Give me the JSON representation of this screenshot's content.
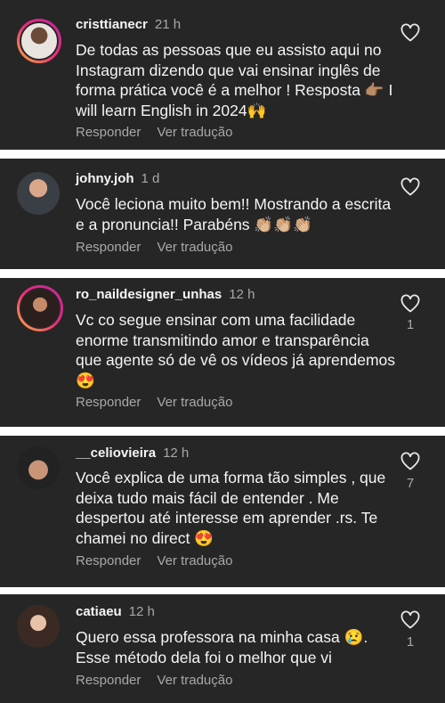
{
  "comments": [
    {
      "username": "cristtianecr",
      "time": "21 h",
      "text": "De todas as pessoas que eu assisto aqui no Instagram dizendo que vai ensinar inglês de forma prática você é a melhor ! Resposta 👉🏽 I will learn English in 2024🙌",
      "reply_label": "Responder",
      "translate_label": "Ver tradução",
      "likes": ""
    },
    {
      "username": "johny.joh",
      "time": "1 d",
      "text": "Você leciona muito bem!! Mostrando a escrita e a pronuncia!! Parabéns 👏🏼👏🏼👏🏼",
      "reply_label": "Responder",
      "translate_label": "Ver tradução",
      "likes": ""
    },
    {
      "username": "ro_naildesigner_unhas",
      "time": "12 h",
      "text": "Vc co segue ensinar com uma facilidade enorme transmitindo amor e transparência que agente só de vê os vídeos já aprendemos😍",
      "reply_label": "Responder",
      "translate_label": "Ver tradução",
      "likes": "1"
    },
    {
      "username": "__celiovieira",
      "time": "12 h",
      "text": "Você explica de uma forma tão simples , que deixa tudo mais fácil de entender . Me despertou até interesse em aprender .rs. Te chamei no direct 😍",
      "reply_label": "Responder",
      "translate_label": "Ver tradução",
      "likes": "7"
    },
    {
      "username": "catiaeu",
      "time": "12 h",
      "text": "Quero essa professora na minha casa 😢. Esse método dela foi o melhor que vi",
      "reply_label": "Responder",
      "translate_label": "Ver tradução",
      "likes": "1"
    }
  ],
  "colors": {
    "card": "#262626",
    "text": "#f5f5f5",
    "muted": "#a8a8a8",
    "story_ring": "#ee2a7b"
  },
  "icons": {
    "like": "heart-outline-icon"
  }
}
